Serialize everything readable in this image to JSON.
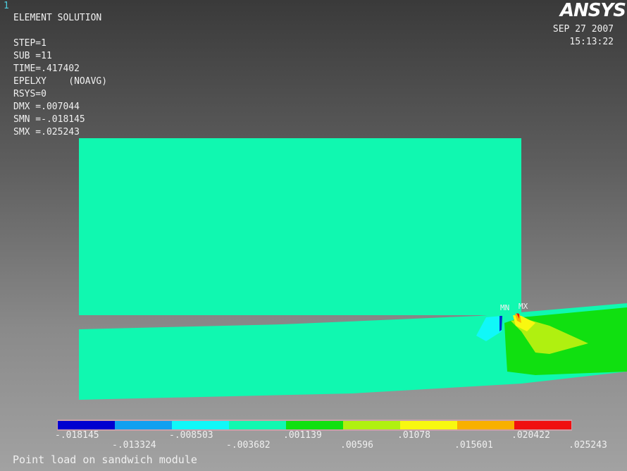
{
  "window_number": "1",
  "header": {
    "lines": [
      "ELEMENT SOLUTION",
      "",
      "STEP=1",
      "SUB =11",
      "TIME=.417402",
      "EPELXY    (NOAVG)",
      "RSYS=0",
      "DMX =.007044",
      "SMN =-.018145",
      "SMX =.025243"
    ]
  },
  "logo": "ANSYS",
  "date": "SEP 27 2007",
  "time": "15:13:22",
  "markers": {
    "min": "MN",
    "max": "MX"
  },
  "legend": {
    "colors": [
      "#0000d0",
      "#10a0f0",
      "#10f8f8",
      "#10f8b0",
      "#10e010",
      "#b0f010",
      "#f8f810",
      "#f8b000",
      "#f01010"
    ],
    "labels": [
      "-.018145",
      "-.013324",
      "-.008503",
      "-.003682",
      ".001139",
      ".00596",
      ".01078",
      ".015601",
      ".020422",
      ".025243"
    ]
  },
  "caption": "Point load on sandwich module"
}
